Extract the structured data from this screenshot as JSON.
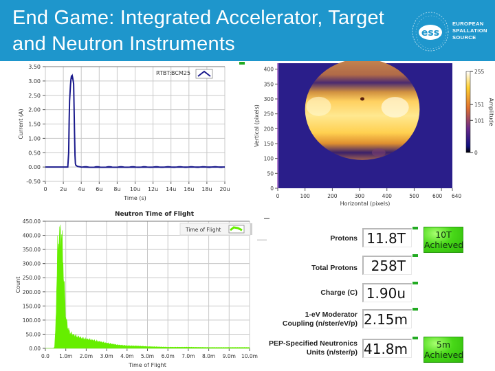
{
  "header": {
    "title_line1": "End Game: Integrated Accelerator, Target",
    "title_line2": "and Neutron Instruments",
    "logo": {
      "mark": "ess",
      "line1": "EUROPEAN",
      "line2": "SPALLATION",
      "line3": "SOURCE"
    },
    "colors": {
      "banner": "#1e96cc"
    }
  },
  "chart_data": [
    {
      "type": "line",
      "title": "",
      "xlabel": "Time (s)",
      "ylabel": "Current (A)",
      "xlim": [
        0,
        20
      ],
      "x_unit": "u",
      "ylim": [
        -0.5,
        3.5
      ],
      "grid": true,
      "legend": {
        "position": "top-right",
        "entries": [
          "RTBT:BCM25"
        ]
      },
      "x_ticks": [
        "0",
        "2u",
        "4u",
        "6u",
        "8u",
        "10u",
        "12u",
        "14u",
        "16u",
        "18u",
        "20u"
      ],
      "y_ticks": [
        "3.50",
        "3.00",
        "2.50",
        "2.00",
        "1.50",
        "1.00",
        "0.50",
        "0.00",
        "-0.50"
      ],
      "series": [
        {
          "name": "RTBT:BCM25",
          "color": "#1a1a8c",
          "x": [
            0,
            2.5,
            2.6,
            2.65,
            2.7,
            2.75,
            2.8,
            2.85,
            2.9,
            2.95,
            3.0,
            3.05,
            3.1,
            3.15,
            3.2,
            3.25,
            3.3,
            3.35,
            3.4,
            3.5,
            3.6,
            4.0,
            5.0,
            20
          ],
          "values": [
            0.0,
            0.0,
            0.5,
            1.6,
            2.3,
            2.6,
            2.85,
            3.05,
            3.15,
            3.12,
            3.17,
            3.1,
            3.0,
            2.9,
            2.0,
            1.2,
            0.4,
            0.12,
            0.06,
            0.04,
            0.02,
            0.0,
            -0.01,
            0.0
          ]
        }
      ]
    },
    {
      "type": "heatmap",
      "title": "",
      "xlabel": "Horizontal (pixels)",
      "ylabel": "Vertical (pixels)",
      "xlim": [
        0,
        640
      ],
      "ylim": [
        0,
        420
      ],
      "x_ticks": [
        "0",
        "100",
        "200",
        "300",
        "400",
        "500",
        "600",
        "640"
      ],
      "y_ticks": [
        "400",
        "350",
        "300",
        "250",
        "200",
        "150",
        "100",
        "50",
        "0"
      ],
      "colorbar": {
        "label": "Amplitude",
        "range": [
          0,
          255
        ],
        "ticks": [
          "255",
          "151",
          "101",
          "0"
        ]
      },
      "description": "Circular beam footprint centered near (310, 265) with radius ~210; bright horizontal band between y 215 and 340, dark band near y 195 and y 360",
      "colors": {
        "background": "#2a1e8a",
        "low": "#3a1e7a",
        "mid": "#c87a3a",
        "high": "#fff0a0"
      }
    },
    {
      "type": "area",
      "title": "Neutron Time of Flight",
      "xlabel": "Time of Flight",
      "ylabel": "Count",
      "xlim": [
        0,
        10
      ],
      "x_unit": "m",
      "ylim": [
        0,
        450
      ],
      "grid": true,
      "legend": {
        "position": "top-right",
        "entries": [
          "Time of Flight"
        ]
      },
      "x_ticks": [
        "0.0",
        "1.0m",
        "2.0m",
        "3.0m",
        "4.0m",
        "5.0m",
        "6.0m",
        "7.0m",
        "8.0m",
        "9.0m",
        "10.0m"
      ],
      "y_ticks": [
        "450.00",
        "400.00",
        "350.00",
        "300.00",
        "250.00",
        "200.00",
        "150.00",
        "100.00",
        "50.00",
        "0.00"
      ],
      "series": [
        {
          "name": "Time of Flight",
          "color": "#66ee00",
          "x": [
            0,
            0.4,
            0.45,
            0.5,
            0.55,
            0.6,
            0.65,
            0.7,
            0.75,
            0.8,
            0.85,
            0.9,
            0.95,
            1.0,
            1.1,
            1.2,
            1.4,
            1.6,
            1.8,
            2.0,
            2.2,
            2.5,
            3.0,
            3.5,
            4.0,
            4.5,
            5.0,
            5.5,
            6.0,
            7.0,
            8.0,
            9.0,
            10.0
          ],
          "values": [
            0,
            0,
            5,
            60,
            200,
            340,
            380,
            395,
            402,
            380,
            330,
            250,
            180,
            110,
            70,
            55,
            45,
            40,
            35,
            32,
            30,
            25,
            18,
            12,
            9,
            8,
            6,
            5,
            4,
            4,
            3,
            3,
            3
          ]
        }
      ]
    }
  ],
  "readouts": [
    {
      "label": "Protons",
      "value": "11.8T",
      "badge": "10T\nAchieved"
    },
    {
      "label": "Total Protons",
      "value": "258T"
    },
    {
      "label": "Charge (C)",
      "value": "1.90u"
    },
    {
      "label": "1-eV Moderator\nCoupling (n/ster/eV/p)",
      "value": "2.15m"
    },
    {
      "label": "PEP-Specified Neutronics\nUnits (n/ster/p)",
      "value": "41.8m",
      "badge": "5m\nAchieved"
    }
  ],
  "badges": {
    "protons_line1": "10T",
    "protons_line2": "Achieved",
    "pep_line1": "5m",
    "pep_line2": "Achieved",
    "color": "#3fd014"
  }
}
